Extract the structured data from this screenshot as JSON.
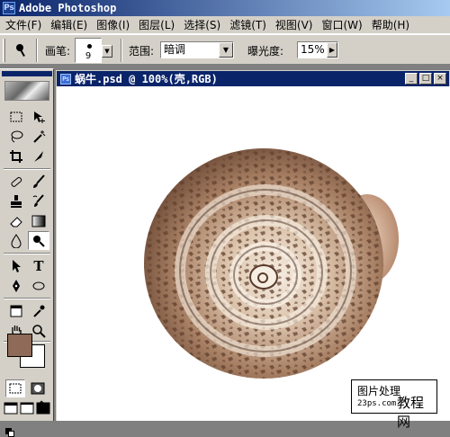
{
  "app": {
    "title": "Adobe Photoshop"
  },
  "menu": [
    "文件(F)",
    "编辑(E)",
    "图像(I)",
    "图层(L)",
    "选择(S)",
    "滤镜(T)",
    "视图(V)",
    "窗口(W)",
    "帮助(H)"
  ],
  "options": {
    "brush_label": "画笔:",
    "brush_size": "9",
    "range_label": "范围:",
    "range_value": "暗调",
    "exposure_label": "曝光度:",
    "exposure_value": "15%"
  },
  "document": {
    "title": "蜗牛.psd @ 100%(壳,RGB)"
  },
  "colors": {
    "foreground": "#8e6a58",
    "background": "#ffffff"
  },
  "watermark": {
    "line1": "图片处理",
    "url": "23ps.com",
    "big": "教程网"
  }
}
